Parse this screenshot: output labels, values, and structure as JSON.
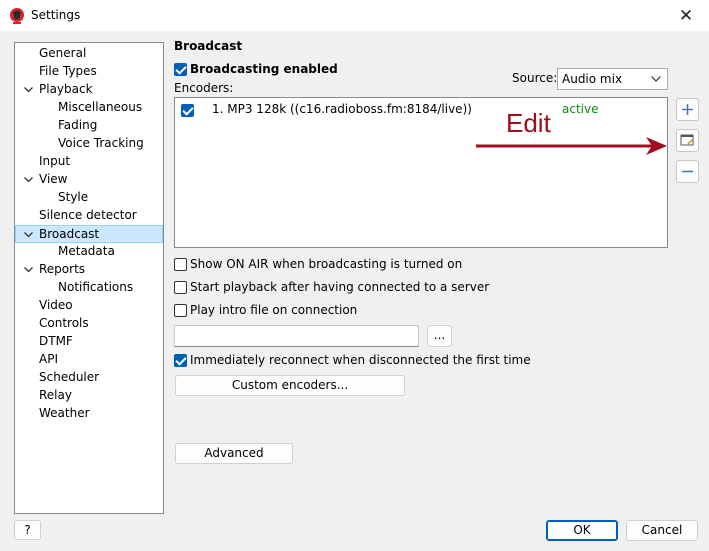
{
  "window": {
    "title": "Settings",
    "close_glyph": "✕"
  },
  "tree": {
    "items": [
      {
        "label": "General"
      },
      {
        "label": "File Types"
      },
      {
        "label": "Playback",
        "expanded": true
      },
      {
        "label": "Miscellaneous"
      },
      {
        "label": "Fading"
      },
      {
        "label": "Voice Tracking"
      },
      {
        "label": "Input"
      },
      {
        "label": "View",
        "expanded": true
      },
      {
        "label": "Style"
      },
      {
        "label": "Silence detector"
      },
      {
        "label": "Broadcast",
        "expanded": true,
        "selected": true
      },
      {
        "label": "Metadata"
      },
      {
        "label": "Reports",
        "expanded": true
      },
      {
        "label": "Notifications"
      },
      {
        "label": "Video"
      },
      {
        "label": "Controls"
      },
      {
        "label": "DTMF"
      },
      {
        "label": "API"
      },
      {
        "label": "Scheduler"
      },
      {
        "label": "Relay"
      },
      {
        "label": "Weather"
      }
    ]
  },
  "broadcast": {
    "title": "Broadcast",
    "enabled_label": "Broadcasting enabled",
    "enabled": true,
    "source_label": "Source:",
    "source_value": "Audio mix",
    "encoders_label": "Encoders:",
    "encoders": [
      {
        "label": "1. MP3 128k ((c16.radioboss.fm:8184/live))",
        "status": "active",
        "checked": true
      }
    ],
    "options": {
      "show_on_air": "Show ON AIR when broadcasting is turned on",
      "start_playback": "Start playback after having connected to a server",
      "play_intro": "Play intro file on connection",
      "reconnect": "Immediately reconnect when disconnected the first time"
    },
    "intro_file_value": "",
    "browse_label": "...",
    "custom_encoders_label": "Custom encoders...",
    "advanced_label": "Advanced"
  },
  "annotation": {
    "text": "Edit"
  },
  "footer": {
    "help_label": "?",
    "ok_label": "OK",
    "cancel_label": "Cancel"
  },
  "colors": {
    "accent": "#005fb8",
    "active_status": "#118a11",
    "annotation": "#a00e1e",
    "selection": "#cce8ff"
  }
}
